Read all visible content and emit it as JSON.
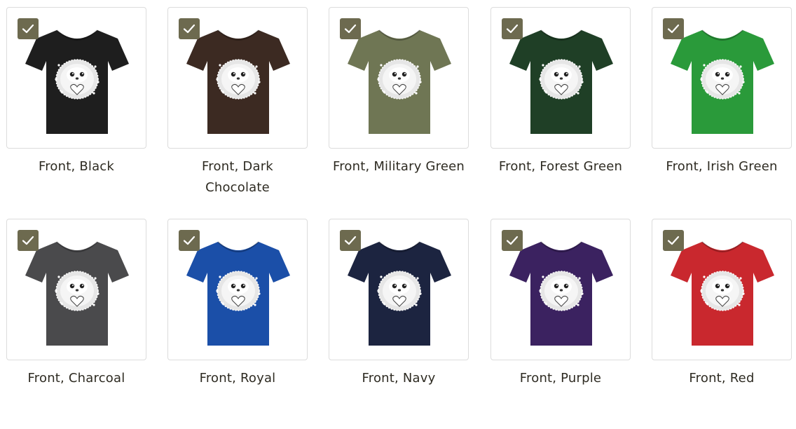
{
  "variants_row1": [
    {
      "label": "Front, Black",
      "color": "#1e1e1e"
    },
    {
      "label": "Front, Dark Chocolate",
      "color": "#3c2a22"
    },
    {
      "label": "Front, Military Green",
      "color": "#6f7654"
    },
    {
      "label": "Front, Forest Green",
      "color": "#1f3f26"
    },
    {
      "label": "Front, Irish Green",
      "color": "#2a9a3a"
    }
  ],
  "variants_row2": [
    {
      "label": "Front, Charcoal",
      "color": "#4a4a4c"
    },
    {
      "label": "Front, Royal",
      "color": "#1b4fa8"
    },
    {
      "label": "Front, Navy",
      "color": "#1c2440"
    },
    {
      "label": "Front, Purple",
      "color": "#3b2260"
    },
    {
      "label": "Front, Red",
      "color": "#c9282e"
    }
  ],
  "checkbox_color": "#6d6a4f",
  "icons": {
    "checkbox": "checkmark-icon",
    "preview": "tshirt-hedgehog-graphic"
  }
}
